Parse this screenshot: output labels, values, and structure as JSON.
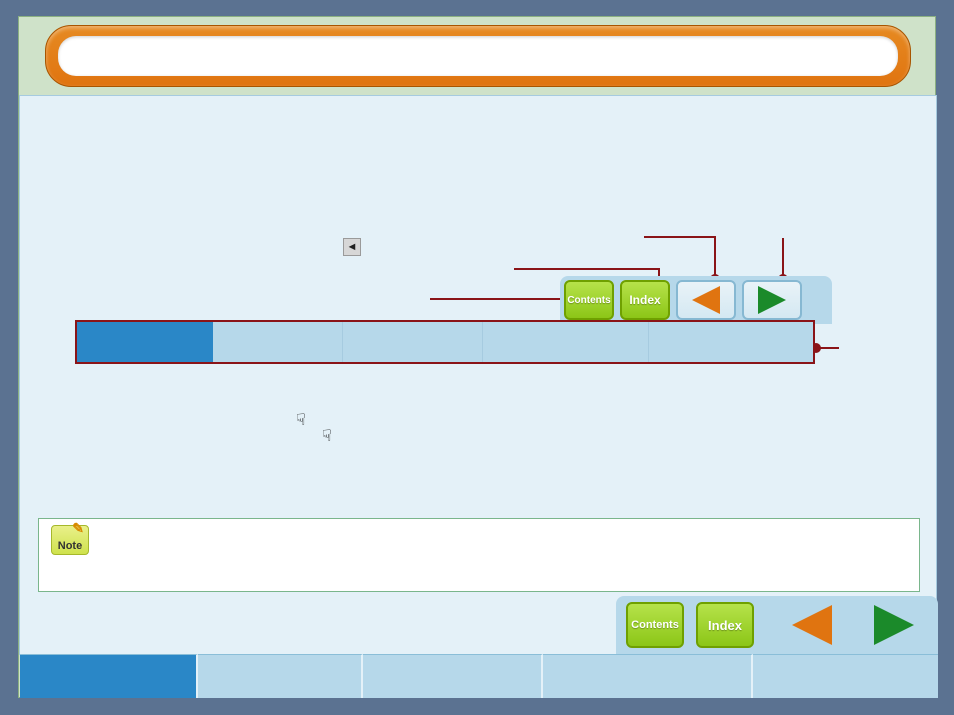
{
  "header": {
    "title": ""
  },
  "diagram": {
    "nav": {
      "contents_label": "Contents",
      "index_label": "Index"
    },
    "tabbar_segments": 5,
    "tabbar_active_index": 0
  },
  "note": {
    "badge": "Note"
  },
  "bottom_nav": {
    "contents_label": "Contents",
    "index_label": "Index"
  },
  "bottom_tabs": {
    "count": 5,
    "active_index": 0
  }
}
